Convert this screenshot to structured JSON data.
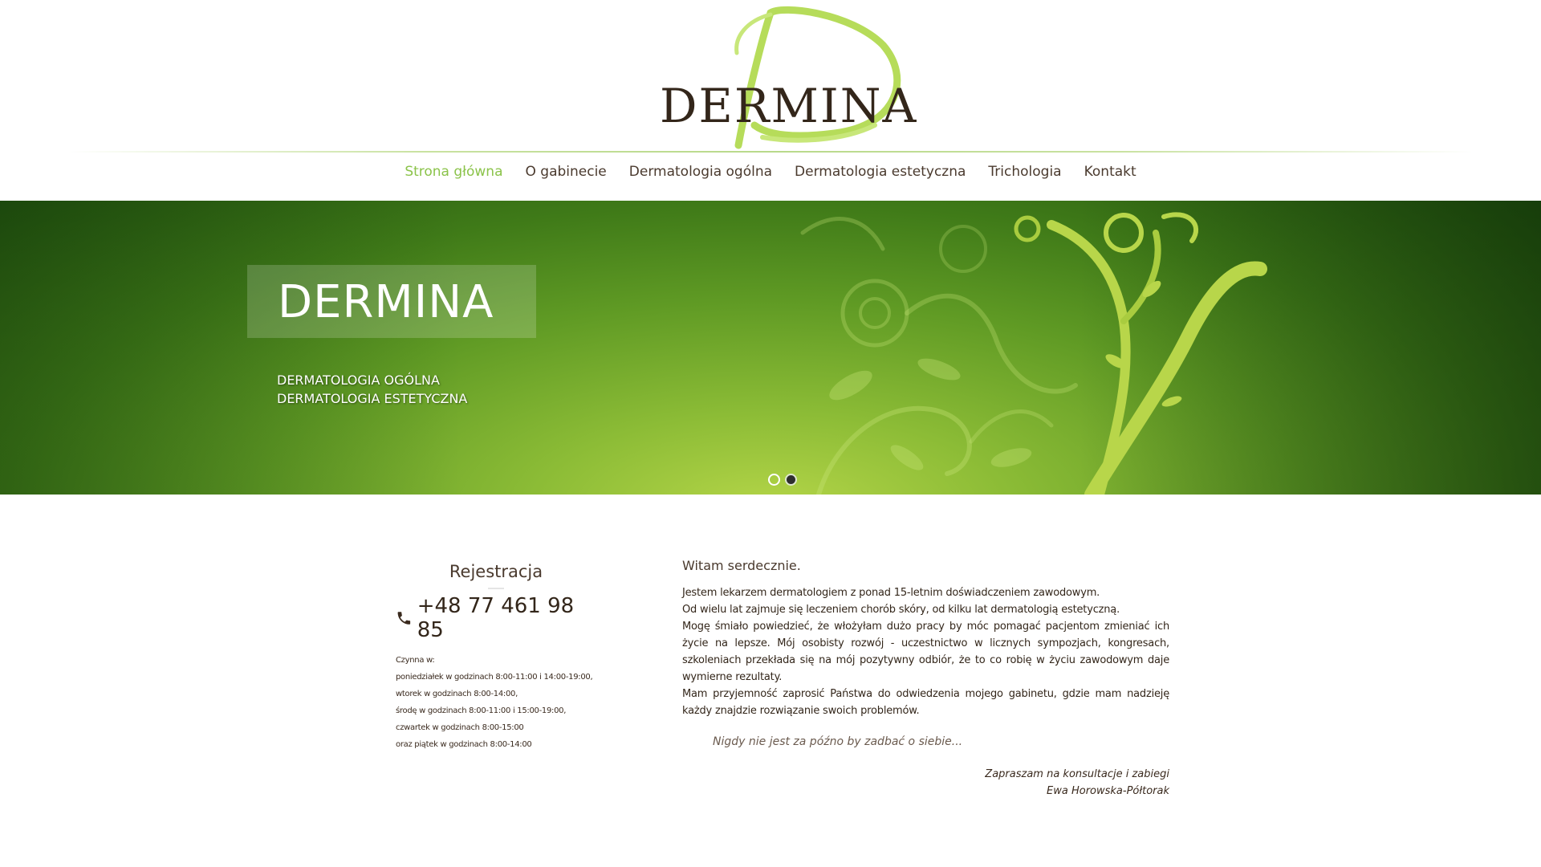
{
  "brand": {
    "logo_text": "DERMINA"
  },
  "nav": {
    "items": [
      {
        "label": "Strona główna",
        "active": true
      },
      {
        "label": "O gabinecie",
        "active": false
      },
      {
        "label": "Dermatologia ogólna",
        "active": false
      },
      {
        "label": "Dermatologia estetyczna",
        "active": false
      },
      {
        "label": "Trichologia",
        "active": false
      },
      {
        "label": "Kontakt",
        "active": false
      }
    ]
  },
  "hero": {
    "title": "DERMINA",
    "subtitle_line1": "DERMATOLOGIA OGÓLNA",
    "subtitle_line2": "DERMATOLOGIA ESTETYCZNA",
    "slides": {
      "count": 2,
      "active": 2
    }
  },
  "registration": {
    "title": "Rejestracja",
    "phone_icon": "phone-icon",
    "phone": "+48 77 461 98 85",
    "hours": [
      "Czynna w:",
      "poniedziałek w godzinach 8:00-11:00 i 14:00-19:00,",
      "wtorek w godzinach 8:00-14:00,",
      "środę w godzinach 8:00-11:00 i 15:00-19:00,",
      "czwartek w godzinach 8:00-15:00",
      "oraz piątek w godzinach 8:00-14:00"
    ]
  },
  "welcome": {
    "greeting": "Witam serdecznie.",
    "paragraphs": [
      "Jestem lekarzem dermatologiem z ponad 15-letnim doświadczeniem zawodowym.",
      "Od wielu lat zajmuje się leczeniem chorób skóry, od kilku lat dermatologią estetyczną.",
      "Mogę śmiało powiedzieć, że włożyłam dużo pracy by móc pomagać pacjentom zmieniać ich życie na lepsze. Mój osobisty rozwój - uczestnictwo w licznych sympozjach, kongresach, szkoleniach przekłada się na mój pozytywny odbiór, że to co robię w życiu zawodowym daje wymierne rezultaty.",
      "Mam przyjemność zaprosić Państwa do odwiedzenia mojego gabinetu, gdzie mam nadzieję każdy znajdzie rozwiązanie swoich problemów."
    ],
    "quote": "Nigdy nie jest za późno by zadbać o siebie...",
    "signoff_line1": "Zapraszam na konsultacje i zabiegi",
    "signoff_line2": "Ewa Horowska-Półtorak"
  },
  "colors": {
    "accent_green": "#8bc34a",
    "text_brown": "#33261a",
    "hero_dark": "#20510e",
    "hero_light": "#b4d548"
  }
}
